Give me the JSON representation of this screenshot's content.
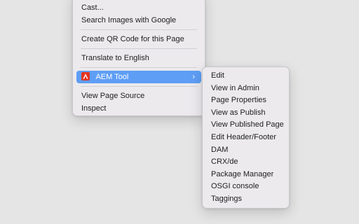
{
  "context_menu": {
    "items": [
      {
        "label": "Cast..."
      },
      {
        "label": "Search Images with Google"
      },
      {
        "label": "Create QR Code for this Page"
      },
      {
        "label": "Translate to English"
      },
      {
        "label": "AEM Tool",
        "icon": "aem-icon",
        "has_submenu": true,
        "highlighted": true
      },
      {
        "label": "View Page Source"
      },
      {
        "label": "Inspect"
      }
    ]
  },
  "submenu": {
    "items": [
      {
        "label": "Edit"
      },
      {
        "label": "View in Admin"
      },
      {
        "label": "Page Properties"
      },
      {
        "label": "View as Publish"
      },
      {
        "label": "View Published Page"
      },
      {
        "label": "Edit Header/Footer"
      },
      {
        "label": "DAM"
      },
      {
        "label": "CRX/de"
      },
      {
        "label": "Package Manager"
      },
      {
        "label": "OSGI console"
      },
      {
        "label": "Taggings"
      }
    ]
  },
  "colors": {
    "highlight": "#5e9ef5",
    "aem_icon": "#e3341f",
    "background": "#e5e5e5"
  }
}
